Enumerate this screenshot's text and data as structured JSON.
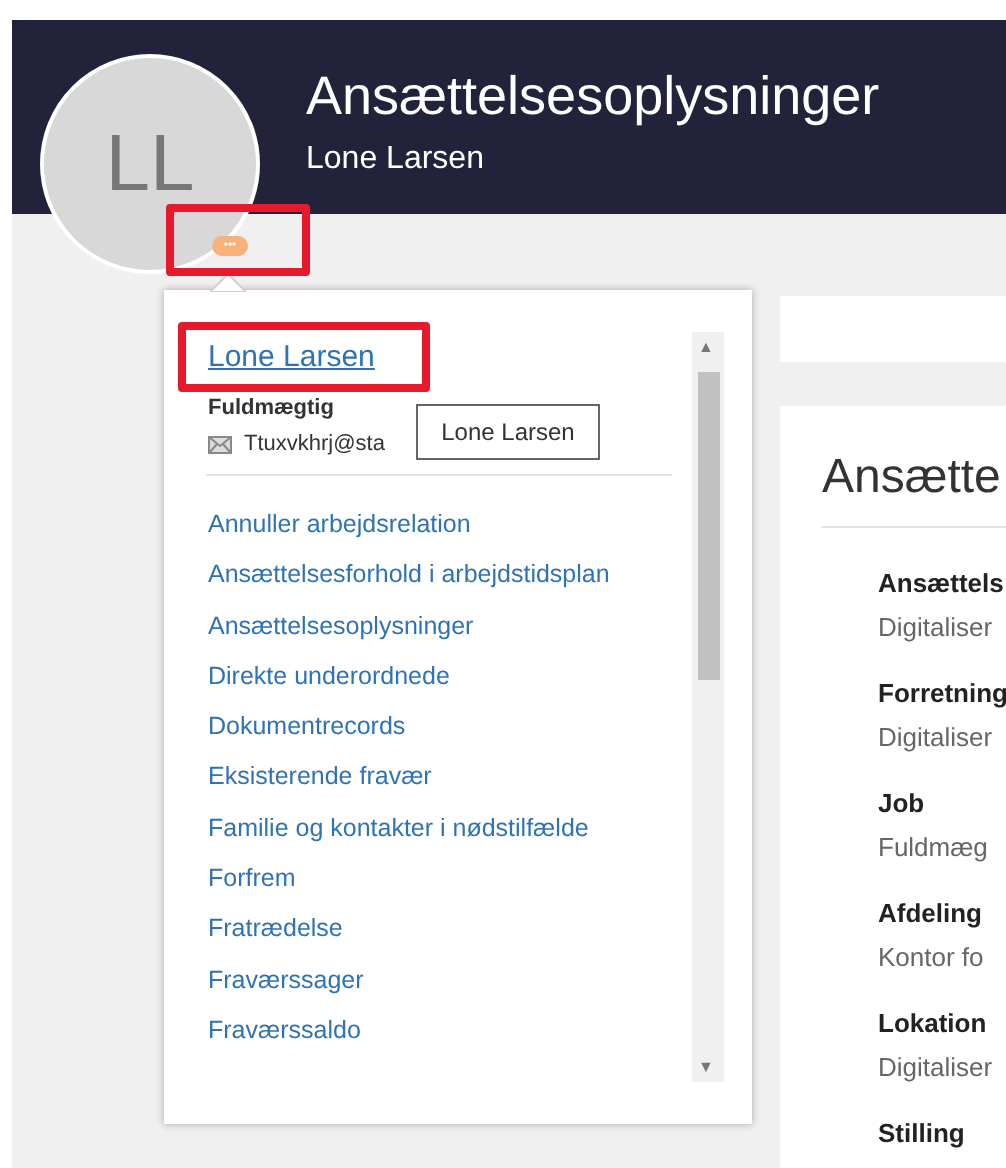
{
  "header": {
    "title": "Ansættelsesoplysninger",
    "subtitle": "Lone Larsen",
    "avatar_initials": "LL",
    "more_badge": "•••"
  },
  "annotations": [
    {
      "kind": "highlight"
    },
    {
      "kind": "highlight"
    }
  ],
  "popup": {
    "name_link": "Lone Larsen",
    "job_title": "Fuldmægtig",
    "email": "Ttuxvkhrj@sta",
    "tooltip": "Lone Larsen",
    "links": [
      "Annuller arbejdsrelation",
      "Ansættelsesforhold i arbejdstidsplan",
      "Ansættelsesoplysninger",
      "Direkte underordnede",
      "Dokumentrecords",
      "Eksisterende fravær",
      "Familie og kontakter i nødstilfælde",
      "Forfrem",
      "Fratrædelse",
      "Fraværssager",
      "Fraværssaldo"
    ],
    "scroll_up": "▲",
    "scroll_down": "▼"
  },
  "panel": {
    "heading": "Ansætte",
    "fields": [
      {
        "label": "Ansættels",
        "value": "Digitaliser"
      },
      {
        "label": "Forretning",
        "value": "Digitaliser"
      },
      {
        "label": "Job",
        "value": "Fuldmæg"
      },
      {
        "label": "Afdeling",
        "value": "Kontor fo"
      },
      {
        "label": "Lokation",
        "value": "Digitaliser"
      },
      {
        "label": "Stilling"
      }
    ]
  }
}
